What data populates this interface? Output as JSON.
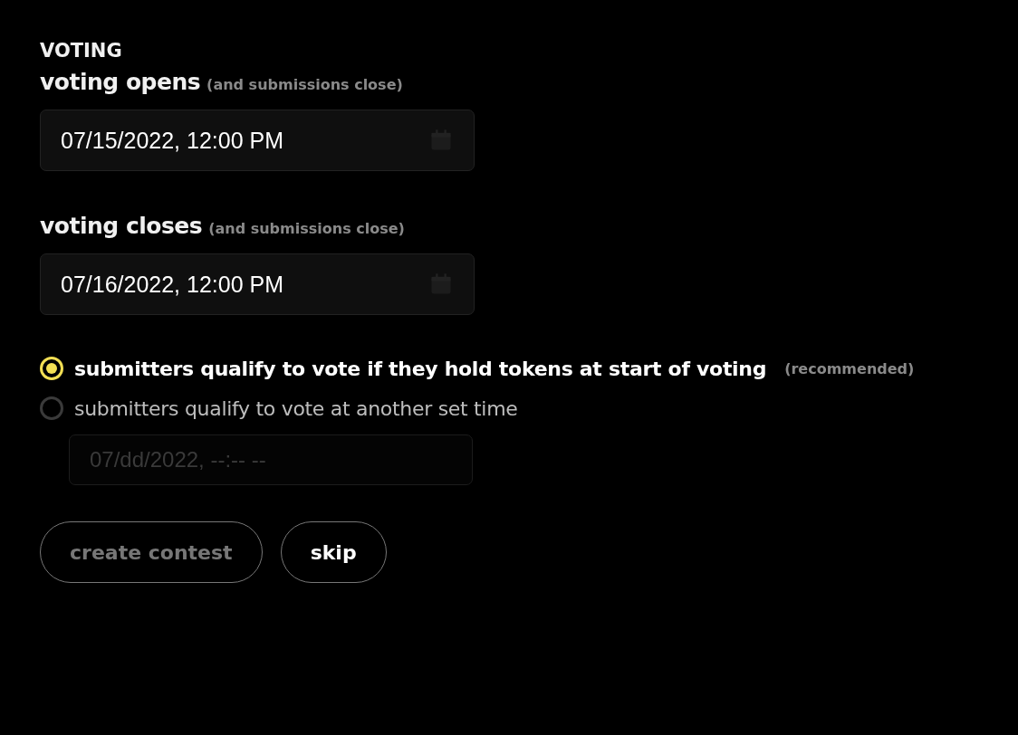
{
  "section_title": "VOTING",
  "fields": [
    {
      "label": "voting opens",
      "note": "(and submissions close)",
      "value": "07/15/2022, 12:00 PM"
    },
    {
      "label": "voting closes",
      "note": "(and submissions close)",
      "value": "07/16/2022, 12:00 PM"
    }
  ],
  "qualify_options": [
    {
      "label": "submitters qualify to vote if they hold tokens at start of voting",
      "note": "(recommended)",
      "selected": true
    },
    {
      "label": "submitters qualify to vote at another set time",
      "selected": false
    }
  ],
  "qualify_time": {
    "value": "07/dd/2022, --:-- --",
    "disabled": true
  },
  "buttons": [
    {
      "label": "create contest",
      "disabled": true
    },
    {
      "label": "skip",
      "disabled": false
    }
  ]
}
